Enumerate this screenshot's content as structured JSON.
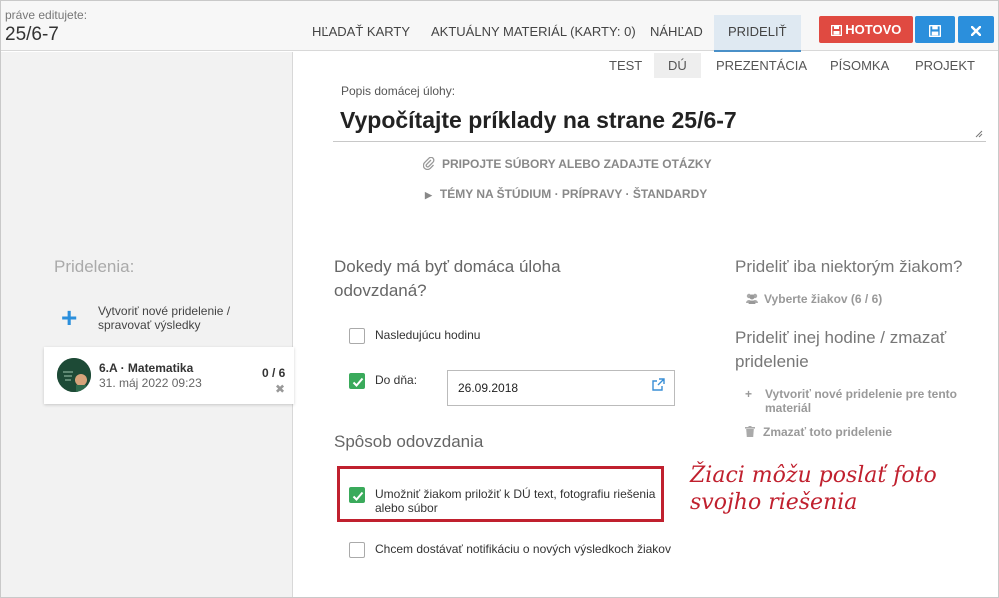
{
  "header": {
    "editing_label": "práve editujete:",
    "editing_title": "25/6-7",
    "nav_tabs": [
      "HĽADAŤ KARTY",
      "AKTUÁLNY MATERIÁL (KARTY: 0)",
      "NÁHĽAD",
      "PRIDELIŤ"
    ],
    "active_tab": "PRIDELIŤ",
    "done_label": "HOTOVO",
    "done_color": "#e04a41",
    "button_color": "#2b8fdc"
  },
  "sidebar": {
    "section_label": "Pridelenia:",
    "new_assignment_label": "Vytvoriť nové pridelenie / spravovať výsledky",
    "card": {
      "class_name": "6.A · Matematika",
      "date": "31. máj 2022 09:23",
      "count": "0 / 6"
    }
  },
  "type_tabs": [
    "TEST",
    "DÚ",
    "PREZENTÁCIA",
    "PÍSOMKA",
    "PROJEKT"
  ],
  "active_type": "DÚ",
  "homework": {
    "description_label": "Popis domácej úlohy:",
    "description": "Vypočítajte príklady na strane 25/6-7",
    "attach_label": "PRIPOJTE SÚBORY ALEBO ZADAJTE OTÁZKY",
    "topics_label": "TÉMY NA ŠTÚDIUM · PRÍPRAVY · ŠTANDARDY"
  },
  "due": {
    "title": "Dokedy má byť domáca úloha odovzdaná?",
    "option_next": "Nasledujúcu hodinu",
    "option_next_checked": false,
    "option_until": "Do dňa:",
    "option_until_checked": true,
    "date_value": "26.09.2018"
  },
  "submission": {
    "title": "Spôsob odovzdania",
    "option_attach": "Umožniť žiakom priložiť k DÚ text, fotografiu riešenia alebo súbor",
    "option_attach_checked": true,
    "option_notify": "Chcem dostávať notifikáciu o nových výsledkoch žiakov",
    "option_notify_checked": false
  },
  "annotation": {
    "line1": "Žiaci môžu poslať foto",
    "line2": "svojho riešenia",
    "color": "#c0202e"
  },
  "right_panel": {
    "some_students_title": "Prideliť iba niektorým žiakom?",
    "select_students": "Vyberte žiakov (6 / 6)",
    "other_lesson_title": "Prideliť inej hodine / zmazať pridelenie",
    "create_new": "Vytvoriť nové pridelenie pre tento materiál",
    "delete": "Zmazať toto pridelenie"
  },
  "colors": {
    "checkbox_checked": "#3aaa5b",
    "accent": "#2b8fdc"
  }
}
